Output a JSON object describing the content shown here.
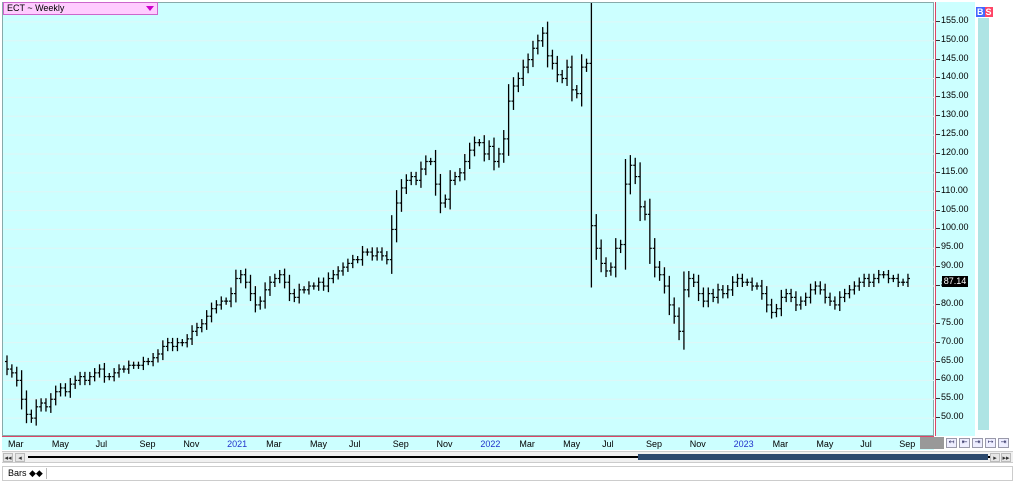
{
  "header": {
    "symbol_label": "ECT ~ Weekly"
  },
  "badges": {
    "b": "B",
    "s": "S"
  },
  "last_price": "87.14",
  "footer": {
    "study_tab": "Bars ◆◆"
  },
  "colors": {
    "plot_bg": "#ccffff",
    "bar": "#000000",
    "axis": "#d44466",
    "year_label": "#2233cc"
  },
  "chart_data": {
    "type": "bar",
    "subtype": "weekly-ohlc",
    "title": "",
    "ylim": [
      45,
      160
    ],
    "y_ticks": [
      "50.00",
      "55.00",
      "60.00",
      "65.00",
      "70.00",
      "75.00",
      "80.00",
      "85.00",
      "90.00",
      "95.00",
      "100.00",
      "105.00",
      "110.00",
      "115.00",
      "120.00",
      "125.00",
      "130.00",
      "135.00",
      "140.00",
      "145.00",
      "150.00",
      "155.00"
    ],
    "x_ticks": [
      {
        "label": "Mar",
        "week": 1,
        "year": false
      },
      {
        "label": "May",
        "week": 10,
        "year": false
      },
      {
        "label": "Jul",
        "week": 19,
        "year": false
      },
      {
        "label": "Sep",
        "week": 28,
        "year": false
      },
      {
        "label": "Nov",
        "week": 37,
        "year": false
      },
      {
        "label": "2021",
        "week": 46,
        "year": true
      },
      {
        "label": "Mar",
        "week": 54,
        "year": false
      },
      {
        "label": "May",
        "week": 63,
        "year": false
      },
      {
        "label": "Jul",
        "week": 71,
        "year": false
      },
      {
        "label": "Sep",
        "week": 80,
        "year": false
      },
      {
        "label": "Nov",
        "week": 89,
        "year": false
      },
      {
        "label": "2022",
        "week": 98,
        "year": true
      },
      {
        "label": "Mar",
        "week": 106,
        "year": false
      },
      {
        "label": "May",
        "week": 115,
        "year": false
      },
      {
        "label": "Jul",
        "week": 123,
        "year": false
      },
      {
        "label": "Sep",
        "week": 132,
        "year": false
      },
      {
        "label": "Nov",
        "week": 141,
        "year": false
      },
      {
        "label": "2023",
        "week": 150,
        "year": true
      },
      {
        "label": "Mar",
        "week": 158,
        "year": false
      },
      {
        "label": "May",
        "week": 167,
        "year": false
      },
      {
        "label": "Jul",
        "week": 176,
        "year": false
      },
      {
        "label": "Sep",
        "week": 184,
        "year": false
      }
    ],
    "weeks": 189,
    "series": [
      {
        "close": [
          63,
          62,
          60,
          55,
          51,
          50,
          53,
          54,
          53,
          55,
          57,
          58,
          57,
          59,
          60,
          61,
          60,
          61,
          62,
          63,
          61,
          61,
          62,
          63,
          63,
          64,
          64,
          64,
          65,
          65,
          66,
          67,
          69,
          70,
          69,
          70,
          70,
          71,
          73,
          74,
          75,
          77,
          79,
          80,
          81,
          81,
          83,
          87,
          88,
          86,
          83,
          80,
          81,
          84,
          86,
          87,
          88,
          86,
          83,
          82,
          84,
          84,
          85,
          85,
          86,
          85,
          87,
          88,
          89,
          90,
          91,
          92,
          92,
          94,
          94,
          93,
          94,
          93,
          92,
          100,
          107,
          111,
          113,
          114,
          113,
          116,
          118,
          118,
          112,
          107,
          108,
          113,
          114,
          115,
          118,
          121,
          123,
          123,
          120,
          122,
          118,
          120,
          124,
          134,
          138,
          140,
          143,
          145,
          148,
          150,
          152,
          146,
          144,
          141,
          140,
          143,
          137,
          136,
          143,
          144,
          101,
          95,
          91,
          89,
          90,
          95,
          96,
          112,
          117,
          114,
          106,
          104,
          95,
          90,
          88,
          85,
          80,
          77,
          73,
          84,
          87,
          86,
          83,
          81,
          83,
          82,
          84,
          83,
          84,
          86,
          87,
          86,
          86,
          85,
          85,
          83,
          80,
          78,
          79,
          82,
          83,
          82,
          80,
          81,
          82,
          84,
          85,
          84,
          82,
          81,
          80,
          82,
          83,
          84,
          85,
          86,
          87,
          86,
          87,
          88,
          88,
          87,
          87,
          86,
          86,
          87
        ]
      }
    ]
  }
}
